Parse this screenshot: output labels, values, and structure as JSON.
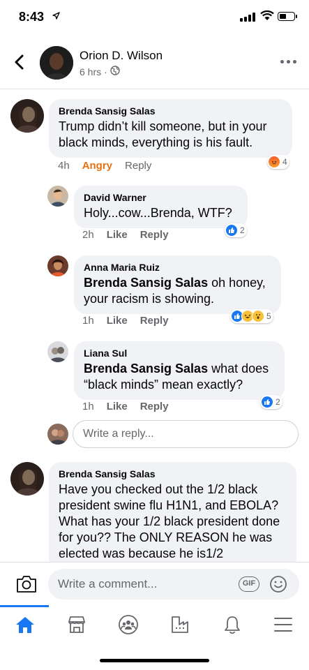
{
  "status_bar": {
    "time": "8:43"
  },
  "header": {
    "name": "Orion D. Wilson",
    "meta": "6 hrs ·"
  },
  "comments": [
    {
      "author": "Brenda Sansig Salas",
      "text": "Trump didn’t kill someone, but in your black minds, everything is his fault.",
      "time": "4h",
      "reaction_label": "Angry",
      "reply_label": "Reply",
      "reaction_count": "4"
    }
  ],
  "replies": [
    {
      "author": "David Warner",
      "text": "Holy...cow...Brenda, WTF?",
      "time": "2h",
      "like_label": "Like",
      "reply_label": "Reply",
      "reaction_count": "2"
    },
    {
      "author": "Anna Maria Ruiz",
      "mention": "Brenda Sansig Salas",
      "text": " oh honey, your racism is showing.",
      "time": "1h",
      "like_label": "Like",
      "reply_label": "Reply",
      "reaction_count": "5"
    },
    {
      "author": "Liana Sul",
      "mention": "Brenda Sansig Salas",
      "text": " what does “black minds” mean exactly?",
      "time": "1h",
      "like_label": "Like",
      "reply_label": "Reply",
      "reaction_count": "2"
    }
  ],
  "reply_input": {
    "placeholder": "Write a reply..."
  },
  "last_comment": {
    "author": "Brenda Sansig Salas",
    "text": "Have you checked out the 1/2 black president swine flu H1N1, and EBOLA? What has your 1/2 black president done for you?? The ONLY REASON he was elected was because he is1/2"
  },
  "comment_bar": {
    "placeholder": "Write a comment...",
    "gif_label": "GIF"
  },
  "nav": {
    "items": [
      "home-icon",
      "marketplace-icon",
      "groups-icon",
      "pages-icon",
      "notifications-icon",
      "menu-icon"
    ],
    "active_color": "#1877f2"
  },
  "colors": {
    "accent": "#1877f2",
    "angry": "#e9710f",
    "bubble": "#f0f2f5",
    "secondary_text": "#65676b"
  }
}
